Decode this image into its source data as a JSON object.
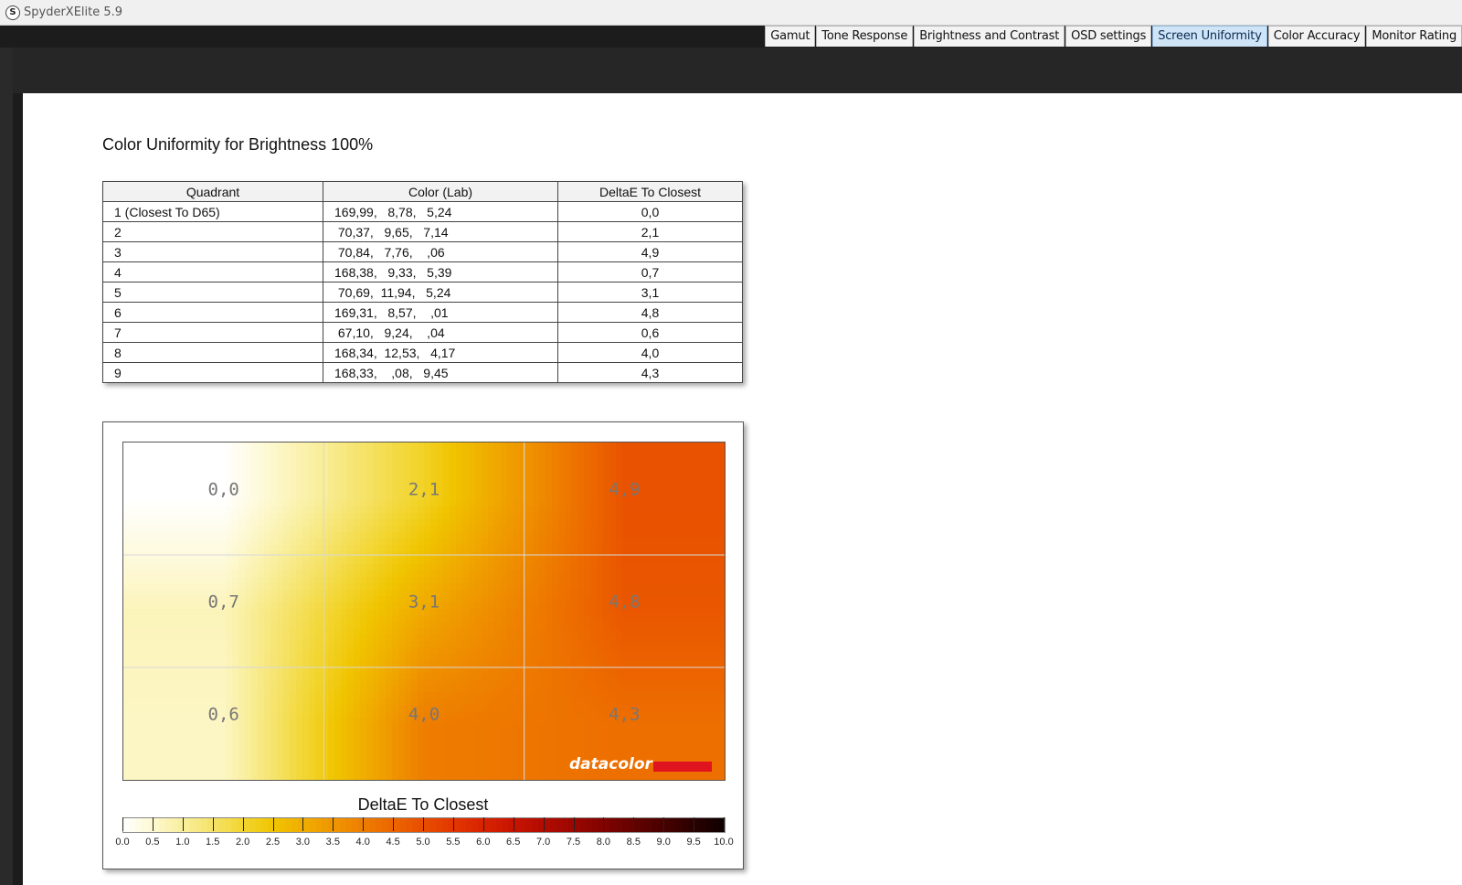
{
  "window": {
    "app_title": "SpyderXElite 5.9",
    "app_icon": "S"
  },
  "tabs": [
    {
      "label": "Gamut",
      "active": false
    },
    {
      "label": "Tone Response",
      "active": false
    },
    {
      "label": "Brightness and Contrast",
      "active": false
    },
    {
      "label": "OSD settings",
      "active": false
    },
    {
      "label": "Screen Uniformity",
      "active": true
    },
    {
      "label": "Color Accuracy",
      "active": false
    },
    {
      "label": "Monitor Rating",
      "active": false
    }
  ],
  "page": {
    "heading": "Color Uniformity for Brightness 100%"
  },
  "table": {
    "headers": [
      "Quadrant",
      "Color (Lab)",
      "DeltaE To Closest"
    ],
    "rows": [
      {
        "quadrant": "1 (Closest To D65)",
        "lab": "169,99,   8,78,   5,24",
        "deltae": "0,0"
      },
      {
        "quadrant": "2",
        "lab": " 70,37,   9,65,   7,14",
        "deltae": "2,1"
      },
      {
        "quadrant": "3",
        "lab": " 70,84,   7,76,    ,06",
        "deltae": "4,9"
      },
      {
        "quadrant": "4",
        "lab": "168,38,   9,33,   5,39",
        "deltae": "0,7"
      },
      {
        "quadrant": "5",
        "lab": " 70,69,  11,94,   5,24",
        "deltae": "3,1"
      },
      {
        "quadrant": "6",
        "lab": "169,31,   8,57,    ,01",
        "deltae": "4,8"
      },
      {
        "quadrant": "7",
        "lab": " 67,10,   9,24,    ,04",
        "deltae": "0,6"
      },
      {
        "quadrant": "8",
        "lab": "168,34,  12,53,   4,17",
        "deltae": "4,0"
      },
      {
        "quadrant": "9",
        "lab": "168,33,    ,08,   9,45",
        "deltae": "4,3"
      }
    ]
  },
  "chart_data": {
    "type": "heatmap",
    "grid_labels": [
      [
        "0,0",
        "2,1",
        "4,9"
      ],
      [
        "0,7",
        "3,1",
        "4,8"
      ],
      [
        "0,6",
        "4,0",
        "4,3"
      ]
    ],
    "grid_values": [
      [
        0.0,
        2.1,
        4.9
      ],
      [
        0.7,
        3.1,
        4.8
      ],
      [
        0.6,
        4.0,
        4.3
      ]
    ],
    "legend_title": "DeltaE To Closest",
    "scale_ticks": [
      "0.0",
      "0.5",
      "1.0",
      "1.5",
      "2.0",
      "2.5",
      "3.0",
      "3.5",
      "4.0",
      "4.5",
      "5.0",
      "5.5",
      "6.0",
      "6.5",
      "7.0",
      "7.5",
      "8.0",
      "8.5",
      "9.0",
      "9.5",
      "10.0"
    ],
    "scale_range": [
      0,
      10
    ],
    "colorscale": [
      "#ffffff",
      "#fdf8cf",
      "#f9ee9b",
      "#f5e266",
      "#f2d52f",
      "#f0c400",
      "#f0ad00",
      "#ef9500",
      "#ee7d00",
      "#ec6500",
      "#e84d00",
      "#e23600",
      "#d82200",
      "#c71400",
      "#b20c00",
      "#9a0600",
      "#7f0300",
      "#630200",
      "#460100",
      "#2a0000",
      "#0d0000"
    ],
    "watermark": "datacolor",
    "watermark_color": "#e0141e"
  }
}
